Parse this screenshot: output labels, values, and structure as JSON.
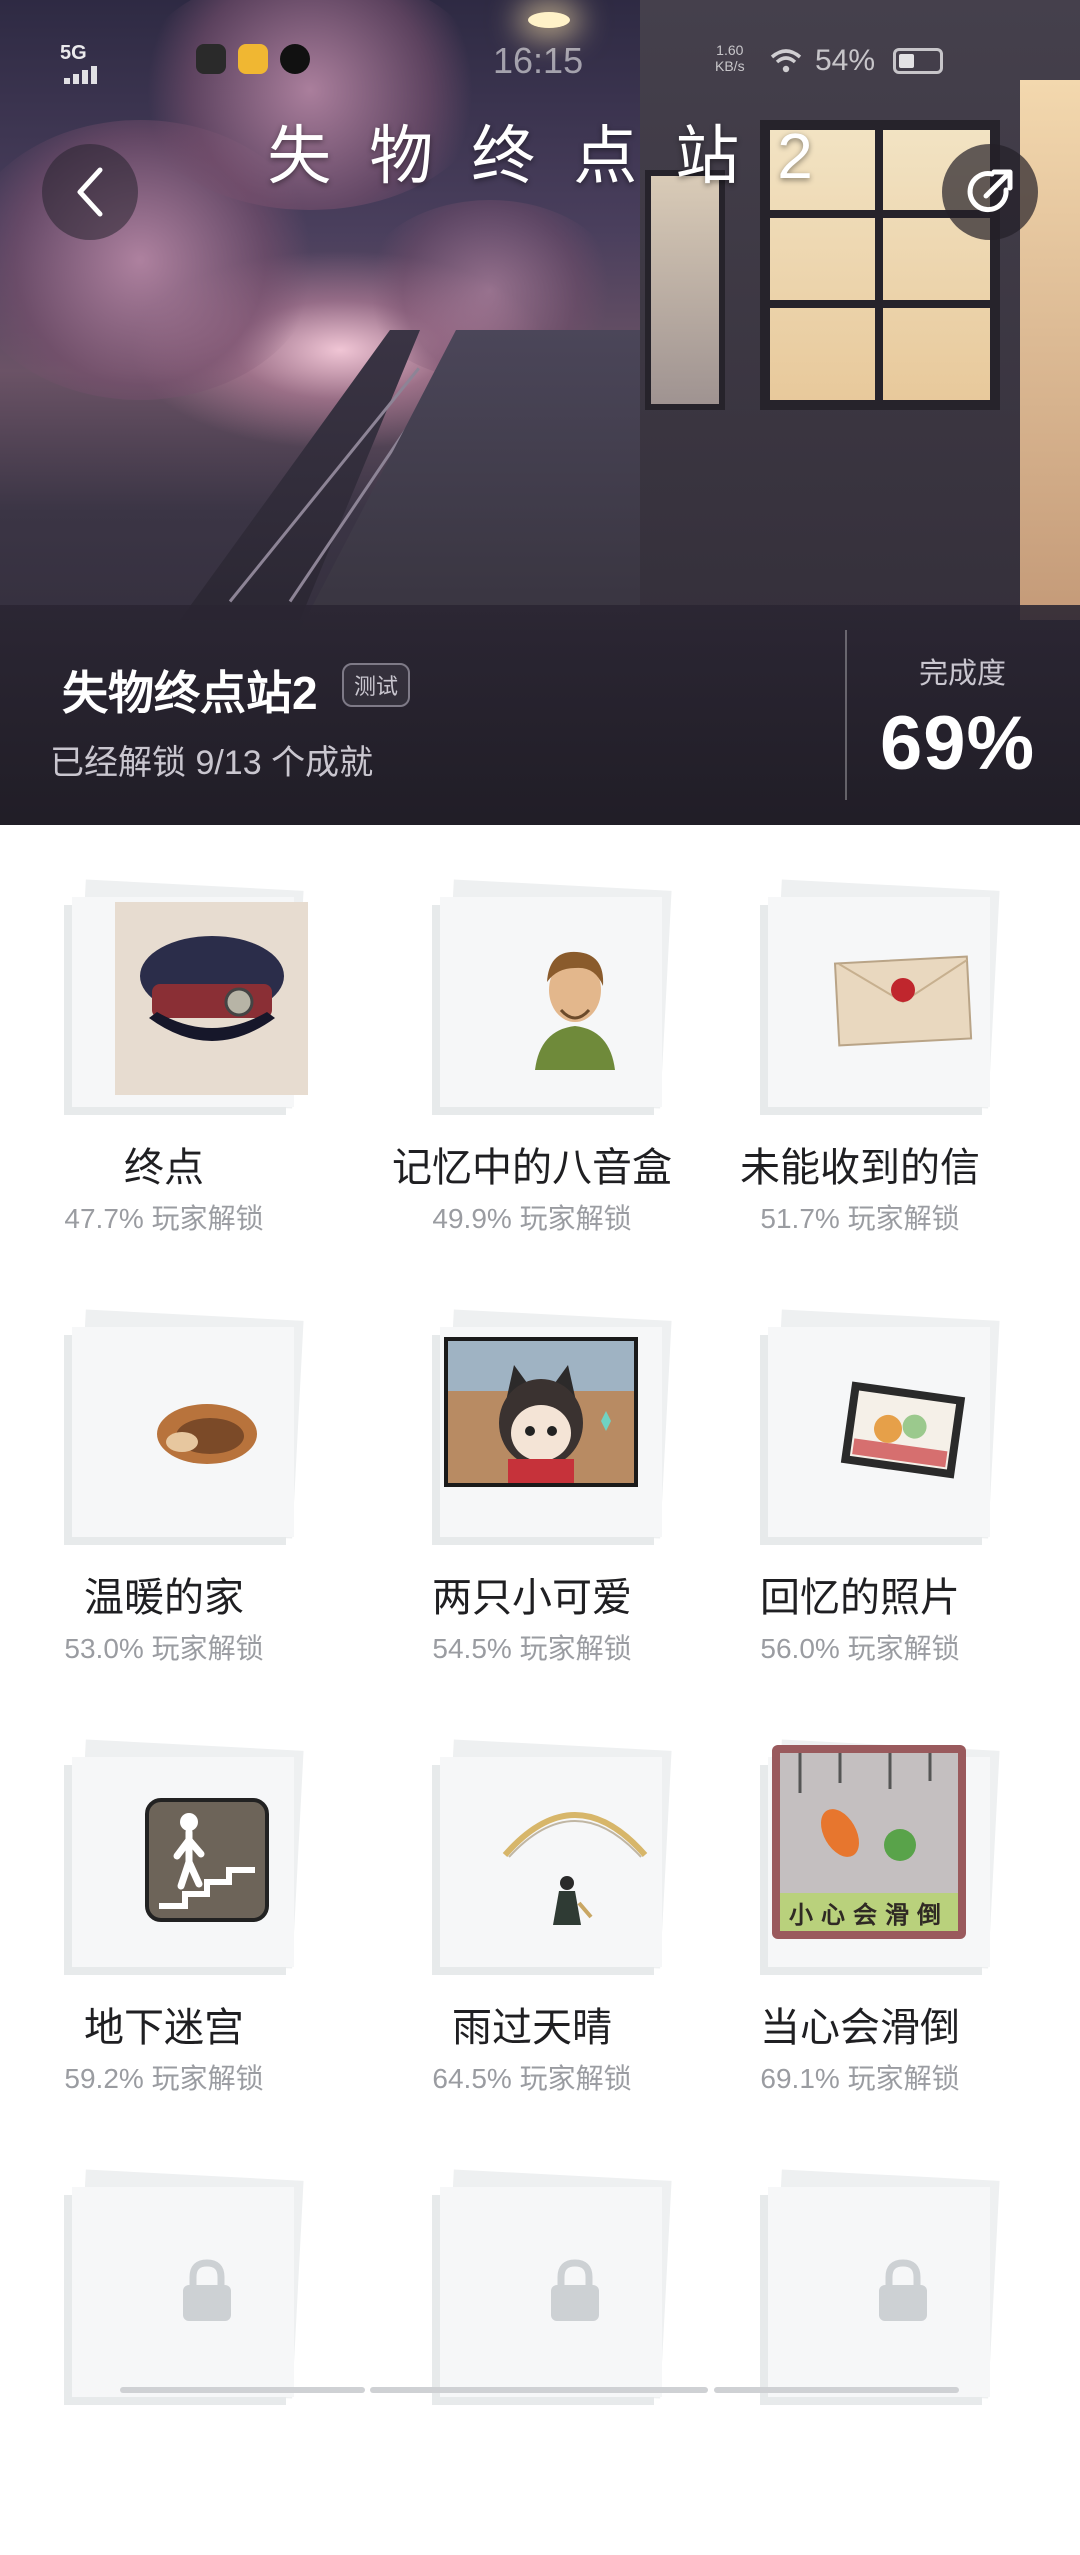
{
  "status_bar": {
    "network": "5G",
    "time": "16:15",
    "speed_value": "1.60",
    "speed_unit": "KB/s",
    "battery": "54%"
  },
  "header": {
    "title": "失物终点站2",
    "back_icon": "chevron-left-icon",
    "share_icon": "share-icon"
  },
  "summary": {
    "game_name": "失物终点站2",
    "badge": "测试",
    "unlock_text": "已经解锁 9/13 个成就",
    "completion_label": "完成度",
    "completion_value": "69%"
  },
  "achievements": [
    {
      "title": "终点",
      "stat": "47.7% 玩家解锁",
      "icon": "conductor-cap-icon",
      "locked": false
    },
    {
      "title": "记忆中的八音盒",
      "stat": "49.9% 玩家解锁",
      "icon": "portrait-icon",
      "locked": false
    },
    {
      "title": "未能收到的信",
      "stat": "51.7% 玩家解锁",
      "icon": "sealed-letter-icon",
      "locked": false
    },
    {
      "title": "温暖的家",
      "stat": "53.0% 玩家解锁",
      "icon": "sleeping-cat-icon",
      "locked": false
    },
    {
      "title": "两只小可爱",
      "stat": "54.5% 玩家解锁",
      "icon": "cat-girl-screen-icon",
      "locked": false
    },
    {
      "title": "回忆的照片",
      "stat": "56.0% 玩家解锁",
      "icon": "photo-frame-icon",
      "locked": false
    },
    {
      "title": "地下迷宫",
      "stat": "59.2% 玩家解锁",
      "icon": "stairs-sign-icon",
      "locked": false
    },
    {
      "title": "雨过天晴",
      "stat": "64.5% 玩家解锁",
      "icon": "rainbow-girl-icon",
      "locked": false
    },
    {
      "title": "当心会滑倒",
      "stat": "69.1% 玩家解锁",
      "icon": "slippery-sign-icon",
      "locked": false,
      "sign_text": "小心会滑倒"
    },
    {
      "title": "",
      "stat": "",
      "icon": "lock-icon",
      "locked": true
    },
    {
      "title": "",
      "stat": "",
      "icon": "lock-icon",
      "locked": true
    },
    {
      "title": "",
      "stat": "",
      "icon": "lock-icon",
      "locked": true
    }
  ],
  "colors": {
    "card_bg": "#f6f7f8",
    "title_text": "#1f1f22",
    "stat_text": "#9a9ca1"
  }
}
